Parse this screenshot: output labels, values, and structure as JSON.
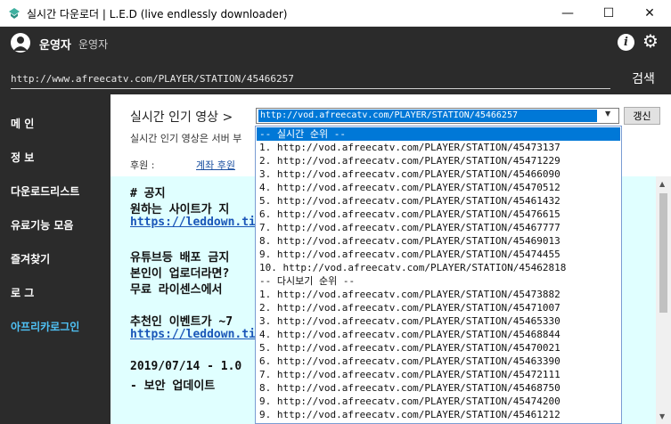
{
  "window": {
    "title": "실시간 다운로더 | L.E.D (live endlessly downloader)",
    "minimize": "—",
    "maximize": "☐",
    "close": "✕"
  },
  "header": {
    "user_name": "운영자",
    "user_role": "운영자",
    "url_value": "http://www.afreecatv.com/PLAYER/STATION/45466257",
    "search_label": "검색"
  },
  "sidebar": {
    "items": [
      {
        "label": "메 인"
      },
      {
        "label": "정 보"
      },
      {
        "label": "다운로드리스트"
      },
      {
        "label": "유료기능 모음"
      },
      {
        "label": "즐겨찾기"
      },
      {
        "label": "로 그"
      },
      {
        "label": "아프리카로그인"
      }
    ],
    "active_color": "#4fc3f7"
  },
  "main": {
    "section_title": "실시간 인기 영상 >",
    "combo_value": "http://vod.afreecatv.com/PLAYER/STATION/45466257",
    "refresh_label": "갱신",
    "desc": "실시간 인기 영상은 서버 부",
    "donate_label": "후원 :",
    "donate_link": "계좌 후원"
  },
  "notice": {
    "lines": [
      {
        "text": "# 공지",
        "link": false
      },
      {
        "text": "원하는 사이트가 지",
        "link": false
      },
      {
        "text": "https://leddown.tis",
        "link": true
      },
      {
        "text": "유튜브등 배포 금지",
        "link": false
      },
      {
        "text": "본인이 업로더라면?",
        "link": false
      },
      {
        "text": "무료 라이센스에서",
        "link": false
      },
      {
        "text": "추천인 이벤트가 ~7",
        "link": false
      },
      {
        "text": "https://leddown.tis",
        "link": true
      },
      {
        "text": "2019/07/14 - 1.0",
        "link": false
      },
      {
        "text": "- 보안 업데이트",
        "link": false
      }
    ]
  },
  "dropdown": {
    "items": [
      "-- 실시간 순위 --",
      "1. http://vod.afreecatv.com/PLAYER/STATION/45473137",
      "2. http://vod.afreecatv.com/PLAYER/STATION/45471229",
      "3. http://vod.afreecatv.com/PLAYER/STATION/45466090",
      "4. http://vod.afreecatv.com/PLAYER/STATION/45470512",
      "5. http://vod.afreecatv.com/PLAYER/STATION/45461432",
      "6. http://vod.afreecatv.com/PLAYER/STATION/45476615",
      "7. http://vod.afreecatv.com/PLAYER/STATION/45467777",
      "8. http://vod.afreecatv.com/PLAYER/STATION/45469013",
      "9. http://vod.afreecatv.com/PLAYER/STATION/45474455",
      "10. http://vod.afreecatv.com/PLAYER/STATION/45462818",
      "-- 다시보기 순위 --",
      "1. http://vod.afreecatv.com/PLAYER/STATION/45473882",
      "2. http://vod.afreecatv.com/PLAYER/STATION/45471007",
      "3. http://vod.afreecatv.com/PLAYER/STATION/45465330",
      "4. http://vod.afreecatv.com/PLAYER/STATION/45468844",
      "5. http://vod.afreecatv.com/PLAYER/STATION/45470021",
      "6. http://vod.afreecatv.com/PLAYER/STATION/45463390",
      "7. http://vod.afreecatv.com/PLAYER/STATION/45472111",
      "8. http://vod.afreecatv.com/PLAYER/STATION/45468750",
      "9. http://vod.afreecatv.com/PLAYER/STATION/45474200",
      "9. http://vod.afreecatv.com/PLAYER/STATION/45461212"
    ]
  }
}
